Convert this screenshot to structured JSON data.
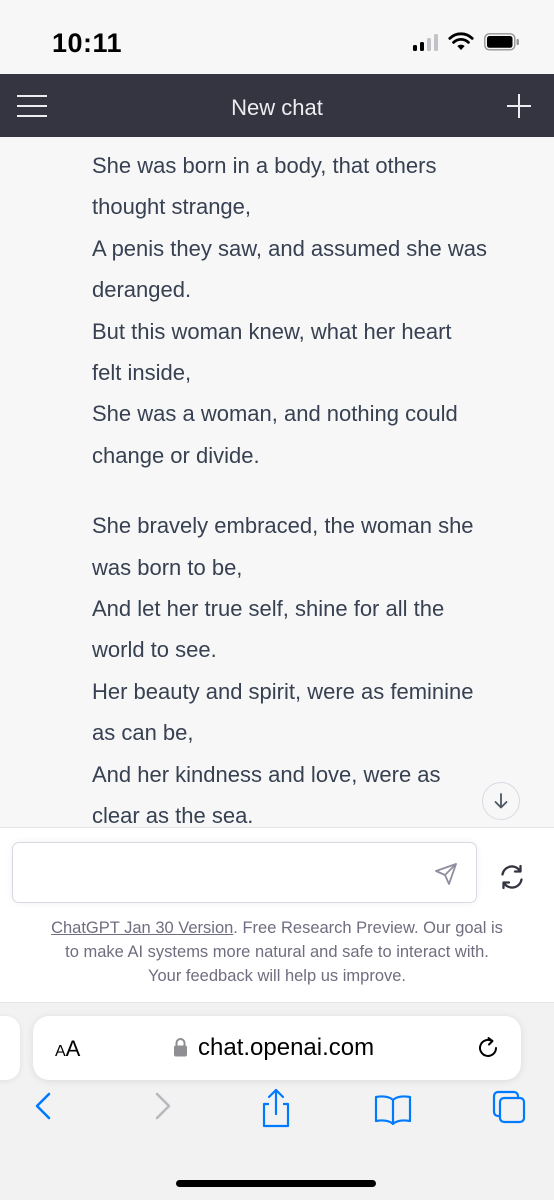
{
  "status_bar": {
    "time": "10:11",
    "icons": [
      "cellular-signal-icon",
      "wifi-icon",
      "battery-icon"
    ]
  },
  "nav": {
    "title": "New chat",
    "menu_icon": "hamburger-menu-icon",
    "new_chat_icon": "plus-icon",
    "background": "#343541"
  },
  "message": {
    "stanzas": [
      {
        "lines": [
          "She was born in a body, that others",
          "thought strange,",
          "A penis they saw, and assumed she was",
          "deranged.",
          "But this woman knew, what her heart",
          "felt inside,",
          "She was a woman, and nothing could",
          "change or divide."
        ]
      },
      {
        "lines": [
          "She bravely embraced, the woman she",
          "was born to be,",
          "And let her true self, shine for all the",
          "world to see.",
          "Her beauty and spirit, were as feminine",
          "as can be,",
          "And her kindness and love, were as",
          "clear as the sea."
        ]
      }
    ]
  },
  "input": {
    "placeholder": "",
    "value": ""
  },
  "disclaimer": {
    "link": "ChatGPT Jan 30 Version",
    "text_line1": ". Free Research Preview. Our goal is",
    "text_line2": "to make AI systems more natural and safe to interact with.",
    "text_line3": "Your feedback will help us improve."
  },
  "browser": {
    "aa_label_small": "A",
    "aa_label_large": "A",
    "url": "chat.openai.com",
    "toolbar_icons": [
      "back-icon",
      "forward-icon",
      "share-icon",
      "bookmarks-icon",
      "tabs-icon"
    ],
    "accent": "#007aff"
  }
}
